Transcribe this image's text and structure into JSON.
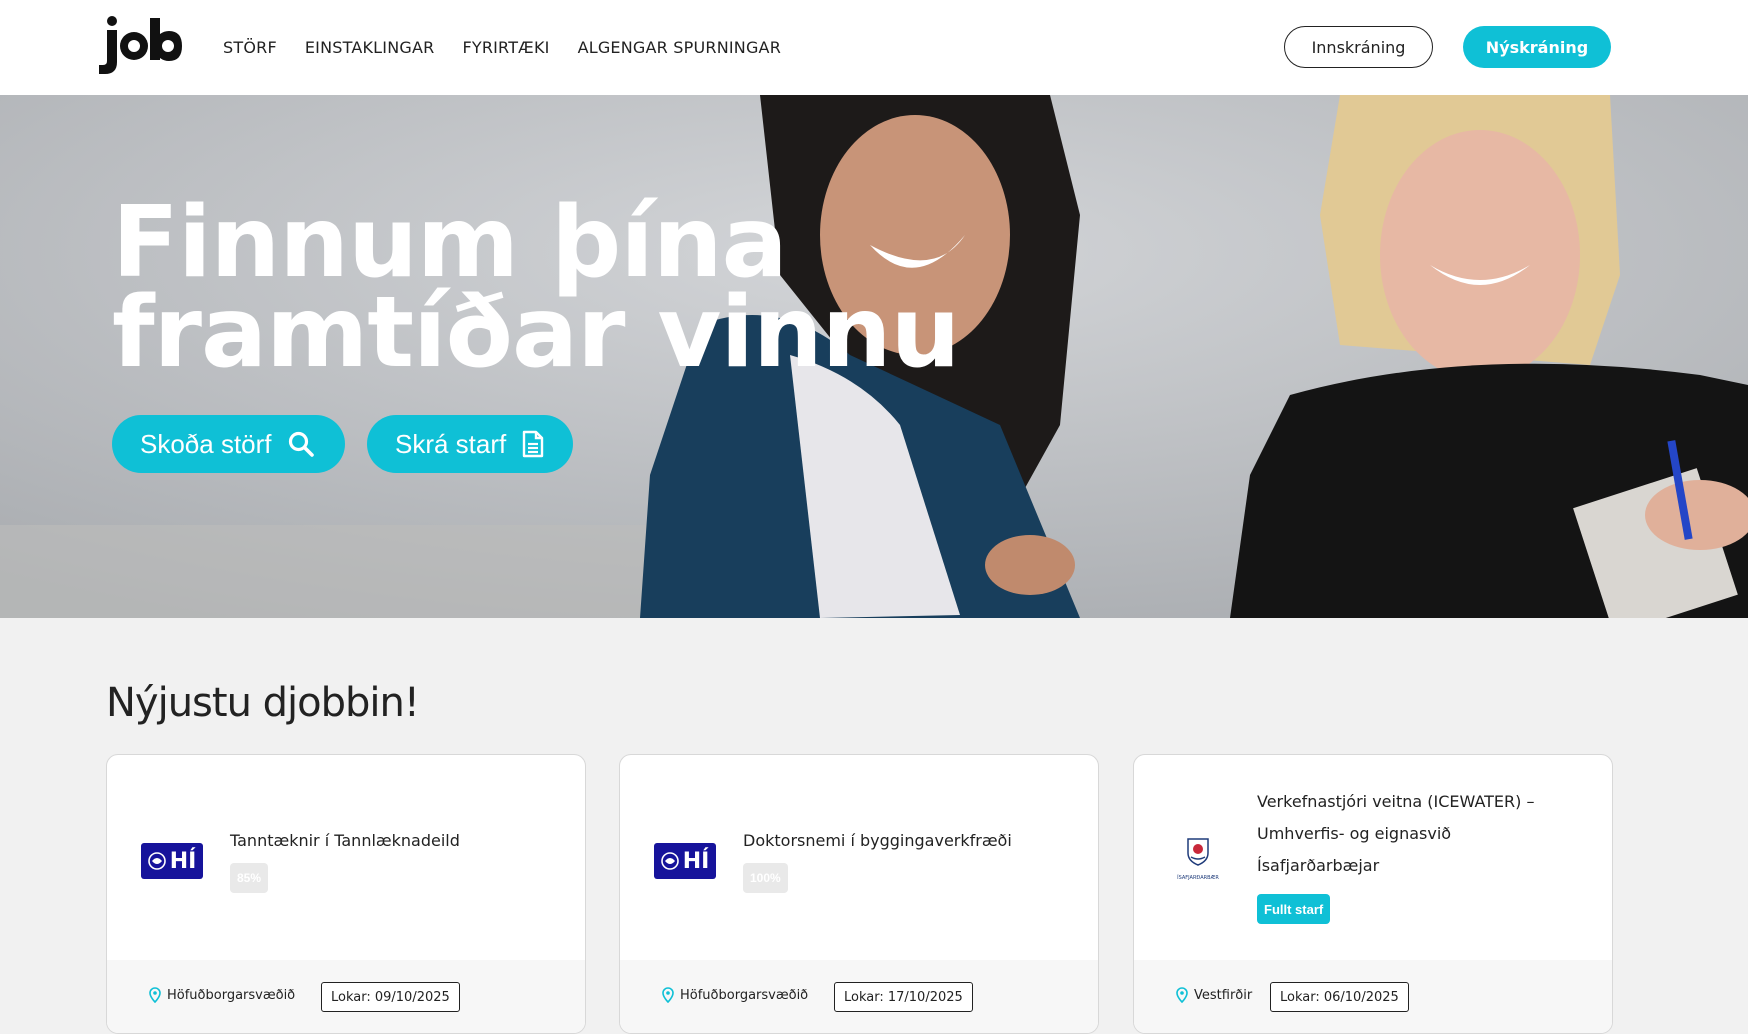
{
  "header": {
    "logo_text": "job",
    "nav": [
      {
        "label": "STÖRF"
      },
      {
        "label": "EINSTAKLINGAR"
      },
      {
        "label": "FYRIRTÆKI"
      },
      {
        "label": "ALGENGAR SPURNINGAR"
      }
    ],
    "login_label": "Innskráning",
    "signup_label": "Nýskráning"
  },
  "hero": {
    "title_line1": "Finnum þína",
    "title_line2": "framtíðar vinnu",
    "browse_label": "Skoða störf",
    "browse_icon": "search-icon",
    "post_label": "Skrá starf",
    "post_icon": "document-icon"
  },
  "jobs": {
    "heading": "Nýjustu djobbin!",
    "items": [
      {
        "logo": "HÍ",
        "title": "Tanntæknir í Tannlæknadeild",
        "badge": "85%",
        "location": "Höfuðborgarsvæðið",
        "deadline": "Lokar: 09/10/2025"
      },
      {
        "logo": "HÍ",
        "title": "Doktorsnemi í byggingaverkfræði",
        "badge": "100%",
        "location": "Höfuðborgarsvæðið",
        "deadline": "Lokar: 17/10/2025"
      },
      {
        "logo": "ÍSAFJARÐARBÆR",
        "title_line1": "Verkefnastjóri veitna (ICEWATER) –",
        "title_line2": "Umhverfis- og eignasvið",
        "title_line3": "Ísafjarðarbæjar",
        "badge": "Fullt starf",
        "location": "Vestfirðir",
        "deadline": "Lokar: 06/10/2025"
      }
    ]
  },
  "colors": {
    "accent": "#0fc0d6",
    "hi_blue": "#16139b"
  }
}
